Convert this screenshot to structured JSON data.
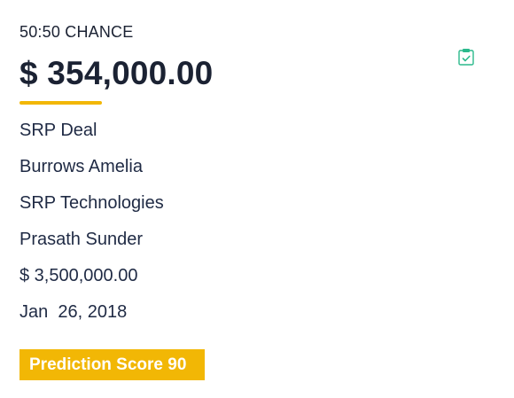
{
  "header": {
    "chance_label": "50:50 CHANCE",
    "amount": "$ 354,000.00"
  },
  "details": {
    "deal_name": "SRP Deal",
    "contact_name": "Burrows Amelia",
    "company": "SRP Technologies",
    "owner": "Prasath Sunder",
    "deal_value": "$ 3,500,000.00",
    "date": "Jan  26, 2018"
  },
  "badge": {
    "prediction_score": "Prediction Score 90"
  },
  "colors": {
    "accent": "#f2b705",
    "icon": "#2bb98c",
    "text": "#1f2a44"
  },
  "icons": {
    "top_right": "clipboard-check-icon"
  }
}
